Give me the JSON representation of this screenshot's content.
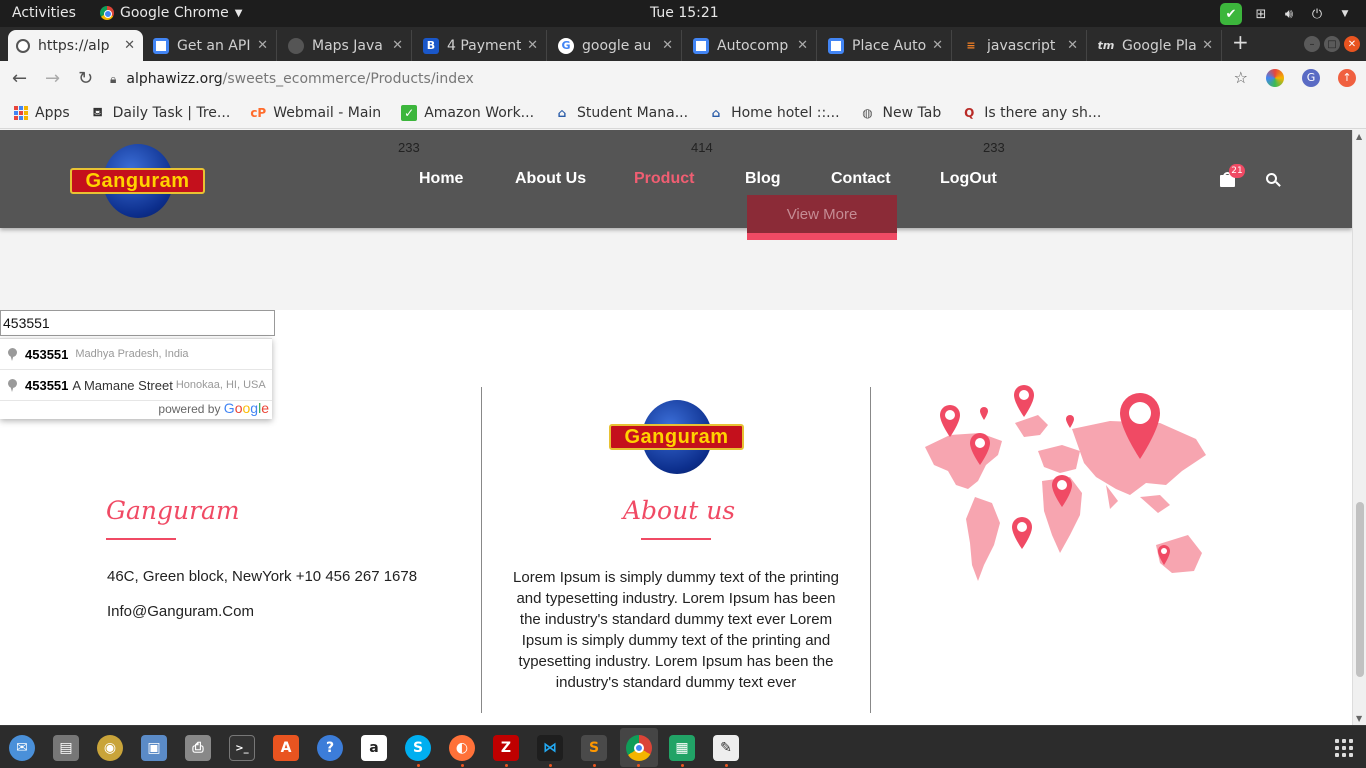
{
  "system_bar": {
    "activities": "Activities",
    "app_name": "Google Chrome",
    "clock": "Tue 15:21"
  },
  "tabs": [
    {
      "title": "https://alp",
      "active": true,
      "favicon": "globe-icon"
    },
    {
      "title": "Get an API",
      "favicon": "maps-api-icon"
    },
    {
      "title": "Maps Java",
      "favicon": "github-icon"
    },
    {
      "title": "4 Payment",
      "favicon": "b-icon"
    },
    {
      "title": "google au",
      "favicon": "google-icon"
    },
    {
      "title": "Autocomp",
      "favicon": "maps-api-icon"
    },
    {
      "title": "Place Auto",
      "favicon": "maps-api-icon"
    },
    {
      "title": "javascript",
      "favicon": "stackoverflow-icon"
    },
    {
      "title": "Google Pla",
      "favicon": "tm-icon"
    }
  ],
  "address_bar": {
    "host": "alphawizz.org",
    "path": "/sweets_ecommerce/Products/index"
  },
  "bookmarks": [
    {
      "label": "Apps",
      "icon": "apps-grid-icon"
    },
    {
      "label": "Daily Task | Tre...",
      "icon": "trello-icon"
    },
    {
      "label": "Webmail - Main",
      "icon": "cpanel-icon"
    },
    {
      "label": "Amazon Work...",
      "icon": "amazon-work-icon"
    },
    {
      "label": "Student Mana...",
      "icon": "home-icon"
    },
    {
      "label": "Home hotel ::...",
      "icon": "home-icon"
    },
    {
      "label": "New Tab",
      "icon": "globe-icon"
    },
    {
      "label": "Is there any sh...",
      "icon": "quora-icon"
    }
  ],
  "site": {
    "logo_text": "Ganguram",
    "counters": [
      "233",
      "414",
      "233"
    ],
    "nav": [
      {
        "label": "Home"
      },
      {
        "label": "About Us"
      },
      {
        "label": "Product",
        "active": true
      },
      {
        "label": "Blog"
      },
      {
        "label": "Contact"
      },
      {
        "label": "LogOut"
      }
    ],
    "cart_count": "21",
    "view_more": "View More"
  },
  "autocomplete": {
    "input_value": "453551",
    "suggestions": [
      {
        "match": "453551",
        "rest": "",
        "secondary": "Madhya Pradesh, India"
      },
      {
        "match": "453551",
        "rest": "A Mamane Street",
        "secondary": "Honokaa, HI, USA"
      }
    ],
    "powered_by": "powered by",
    "google": "Google"
  },
  "footer": {
    "col1": {
      "title": "Ganguram",
      "address": "46C, Green block, NewYork  +10 456 267 1678",
      "email": "Info@Ganguram.Com"
    },
    "col2": {
      "title": "About us",
      "body": "Lorem Ipsum is simply dummy text of the printing and typesetting industry. Lorem Ipsum has been the industry's standard dummy text ever Lorem Ipsum is simply dummy text of the printing and typesetting industry. Lorem Ipsum has been the industry's standard dummy text ever"
    },
    "col3": {
      "image": "world-map-pins"
    }
  },
  "colors": {
    "accent": "#f04a64",
    "header_bg": "#555555",
    "ubuntu_orange": "#e95420"
  }
}
